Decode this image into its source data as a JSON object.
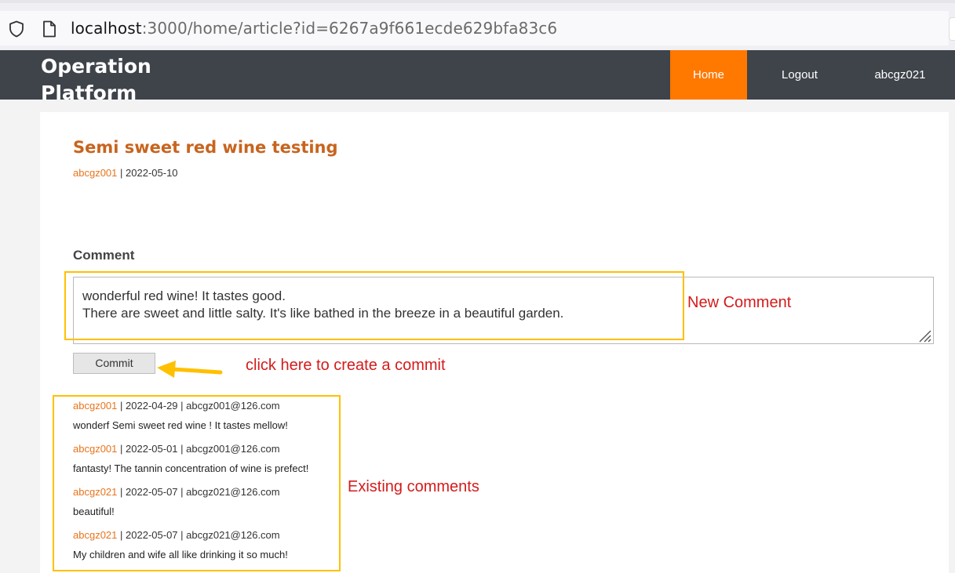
{
  "browser": {
    "url_host": "localhost",
    "url_path": ":3000/home/article?id=6267a9f661ecde629bfa83c6"
  },
  "nav": {
    "brand_line1": "Operation",
    "brand_line2": "Platform",
    "home": "Home",
    "logout": "Logout",
    "user": "abcgz021"
  },
  "article": {
    "title": "Semi sweet red wine testing",
    "author": "abcgz001",
    "separator": "|",
    "date": "2022-05-10"
  },
  "comment_form": {
    "label": "Comment",
    "value": "wonderful red wine! It tastes good.\nThere are sweet and little salty. It's like bathed in the breeze in a beautiful garden.",
    "commit_label": "Commit"
  },
  "annotations": {
    "new_comment": "New Comment",
    "click_hint": "click here to create a commit",
    "existing": "Existing comments",
    "accent_color": "#ffc000",
    "annotation_color": "#d41b1b"
  },
  "comments": [
    {
      "author": "abcgz001",
      "date": "2022-04-29",
      "email": "abcgz001@126.com",
      "text": "wonderf Semi sweet red wine ! It tastes mellow!"
    },
    {
      "author": "abcgz001",
      "date": "2022-05-01",
      "email": "abcgz001@126.com",
      "text": "fantasty! The tannin concentration of wine is prefect!"
    },
    {
      "author": "abcgz021",
      "date": "2022-05-07",
      "email": "abcgz021@126.com",
      "text": "beautiful!"
    },
    {
      "author": "abcgz021",
      "date": "2022-05-07",
      "email": "abcgz021@126.com",
      "text": "My children and wife all like drinking it so much!"
    }
  ],
  "colors": {
    "nav_bg": "#3f444b",
    "nav_active": "#ff7800",
    "title": "#c8641e",
    "author_link": "#e8741c"
  }
}
